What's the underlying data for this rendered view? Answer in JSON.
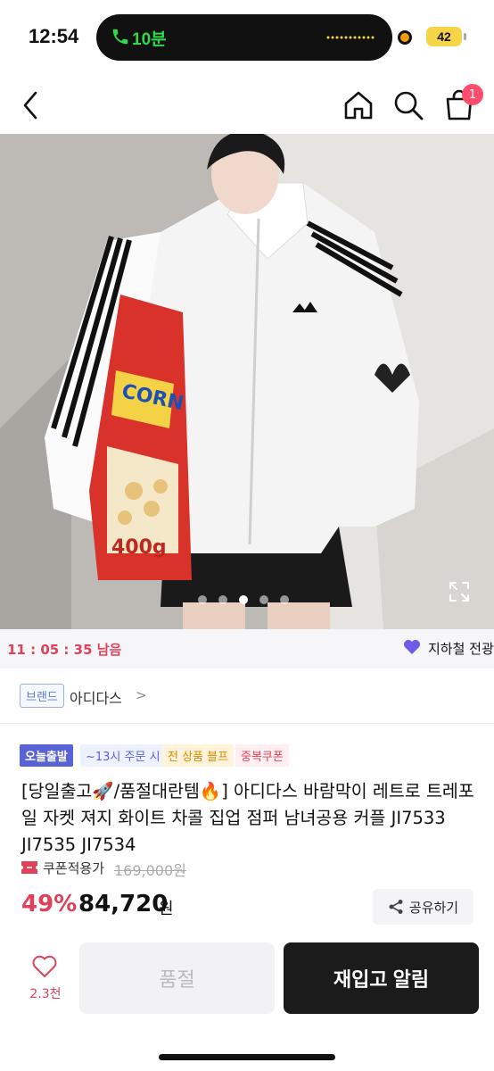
{
  "status_bar": {
    "time": "12:54",
    "call_duration": "10분",
    "battery": "42"
  },
  "nav": {
    "cart_count": "1",
    "back_icon": "chevron-left-icon",
    "home_icon": "home-icon",
    "search_icon": "search-icon",
    "cart_icon": "shopping-bag-icon"
  },
  "gallery": {
    "image_count": 5,
    "active_index": 2
  },
  "timer_bar": {
    "timer": "11 : 05 : 35 남음",
    "delivery_label": "지하철 전광"
  },
  "brand": {
    "tag": "브랜드",
    "name": "아디다스",
    "chevron": ">"
  },
  "badges": [
    "오늘출발",
    "~13시 주문 시",
    "전 상품 블프",
    "중복쿠폰"
  ],
  "product": {
    "title": "[당일출고🚀/품절대란템🔥] 아디다스 바람막이 레트로 트레포일 자켓 져지 화이트 차콜 집업 점퍼 남녀공용 커플 JI7533 JI7535 JI7534",
    "coupon_label": "쿠폰적용가",
    "original_price": "169,000원",
    "discount": "49%",
    "price": "84,720",
    "currency": "원",
    "share_label": "공유하기"
  },
  "bottom_bar": {
    "like_count": "2.3천",
    "soldout_label": "품절",
    "restock_label": "재입고 알림"
  },
  "colors": {
    "accent_red": "#e0415a",
    "badge_blue": "#5864d6",
    "dark_button": "#1b1b1b"
  }
}
